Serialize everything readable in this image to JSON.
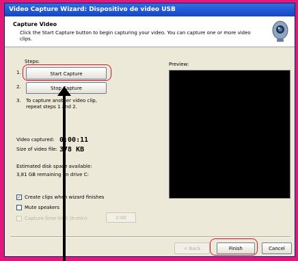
{
  "window": {
    "title": "Video Capture Wizard: Dispositivo de video USB"
  },
  "header": {
    "title": "Capture Video",
    "description": "Click the Start Capture button to begin capturing your video. You can capture one or more video clips.",
    "camera_icon": "webcam-icon"
  },
  "steps": {
    "label": "Steps:",
    "step1_num": "1.",
    "step2_num": "2.",
    "step3_num": "3.",
    "start_capture": "Start Capture",
    "stop_capture": "Stop Capture",
    "step3_text": "To capture another video clip, repeat steps 1 and 2."
  },
  "stats": {
    "video_captured_label": "Video captured:",
    "video_captured_value": "0:00:11",
    "size_label": "Size of video file:",
    "size_value": "378 KB",
    "disk_label": "Estimated disk space available:",
    "disk_value": "3,81 GB remaining on drive C:"
  },
  "options": {
    "create_clips": "Create clips when wizard finishes",
    "create_clips_checked": true,
    "mute_speakers": "Mute speakers",
    "mute_speakers_checked": false,
    "capture_time_limit": "Capture time limit (h:min):",
    "time_value": "2:00"
  },
  "preview": {
    "label": "Preview:"
  },
  "footer": {
    "back": "< Back",
    "finish": "Finish",
    "cancel": "Cancel"
  },
  "colors": {
    "highlight": "#e0103a",
    "frame": "#e0187a"
  }
}
